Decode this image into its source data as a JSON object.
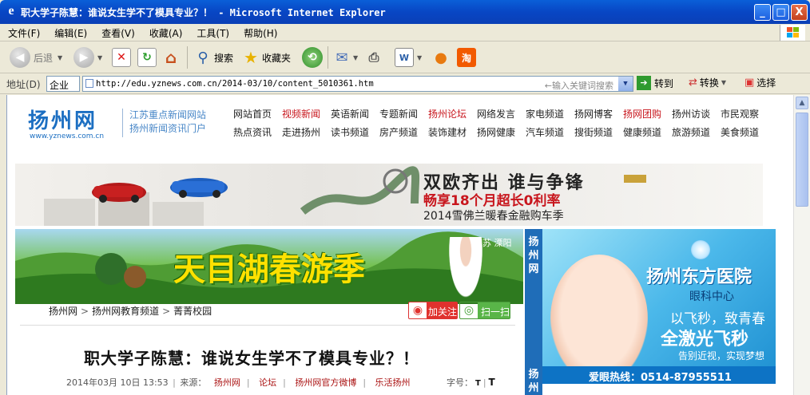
{
  "window": {
    "title": "职大学子陈慧：谁说女生学不了模具专业？！ - Microsoft Internet Explorer",
    "min": "_",
    "max": "□",
    "close": "X"
  },
  "menu": [
    "文件(F)",
    "编辑(E)",
    "查看(V)",
    "收藏(A)",
    "工具(T)",
    "帮助(H)"
  ],
  "toolbar": {
    "back": "后退",
    "search": "搜索",
    "favorites": "收藏夹"
  },
  "address": {
    "label": "地址(D)",
    "scope": "企业",
    "url": "http://edu.yznews.com.cn/2014-03/10/content_5010361.htm",
    "hint": "←输入关键词搜索",
    "go": "转到",
    "convert": "转换",
    "select": "选择"
  },
  "site": {
    "logo": "扬州网",
    "logo_url": "www.yznews.com.cn",
    "slogan1": "江苏重点新闻网站",
    "slogan2": "扬州新闻资讯门户",
    "nav": [
      {
        "label": "网站首页",
        "red": false
      },
      {
        "label": "视频新闻",
        "red": true
      },
      {
        "label": "英语新闻",
        "red": false
      },
      {
        "label": "专题新闻",
        "red": false
      },
      {
        "label": "扬州论坛",
        "red": true
      },
      {
        "label": "网络发言",
        "red": false
      },
      {
        "label": "家电频道",
        "red": false
      },
      {
        "label": "扬网博客",
        "red": false
      },
      {
        "label": "扬网团购",
        "red": true
      },
      {
        "label": "扬州访谈",
        "red": false
      },
      {
        "label": "市民观察",
        "red": false
      },
      {
        "label": "热点资讯",
        "red": false
      },
      {
        "label": "走进扬州",
        "red": false
      },
      {
        "label": "读书频道",
        "red": false
      },
      {
        "label": "房产频道",
        "red": false
      },
      {
        "label": "装饰建材",
        "red": false
      },
      {
        "label": "扬网健康",
        "red": false
      },
      {
        "label": "汽车频道",
        "red": false
      },
      {
        "label": "搜街频道",
        "red": false
      },
      {
        "label": "健康频道",
        "red": false
      },
      {
        "label": "旅游频道",
        "red": false
      },
      {
        "label": "美食频道",
        "red": false
      }
    ]
  },
  "banner1": {
    "t1": "双欧齐出 谁与争锋",
    "t2": "畅享18个月超长0利率",
    "t3": "2014雪佛兰暖春金融购车季"
  },
  "banner2": {
    "title": "天目湖春游季",
    "loc": "江苏 溧阳"
  },
  "sidebar": {
    "label1": "扬州网",
    "label2": "扬州"
  },
  "ad": {
    "name": "扬州东方医院",
    "dept": "眼科中心",
    "slogan": "以飞秒，致青春",
    "main": "全激光飞秒",
    "sub": "告别近视，实现梦想",
    "hotline": "爱眼热线：0514-87955511"
  },
  "crumb": {
    "a": "扬州网",
    "b": "扬州网教育频道",
    "c": "菁菁校园"
  },
  "social": {
    "follow": "加关注",
    "scan": "扫一扫"
  },
  "article": {
    "title": "职大学子陈慧：谁说女生学不了模具专业？！",
    "date": "2014年03月 10日 13:53",
    "source_label": "来源：",
    "s1": "扬州网",
    "s2": "论坛",
    "s3": "扬州网官方微博",
    "s4": "乐活扬州",
    "fontsize": "字号：",
    "t1": "T",
    "t2": "T"
  }
}
